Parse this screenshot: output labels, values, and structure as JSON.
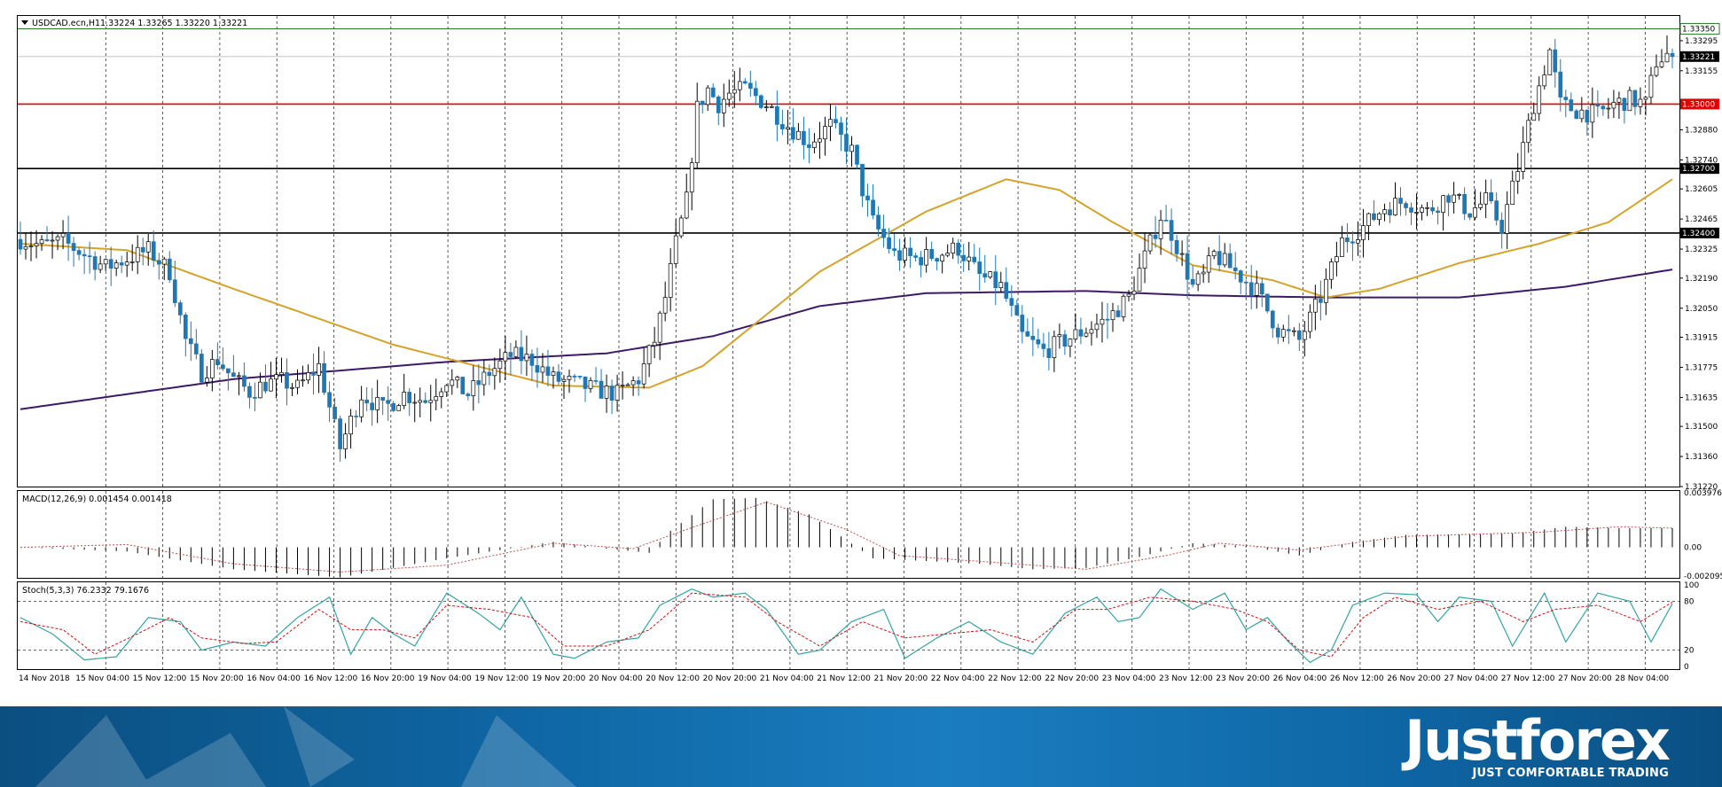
{
  "header": {
    "symbol_text": "USDCAD.ecn,H1",
    "ohlc_text": "1.33224 1.33265 1.33220 1.33221"
  },
  "macd_label": "MACD(12,26,9) 0.001454 0.001418",
  "stoch_label": "Stoch(5,3,3) 76.2332 79.1676",
  "colors": {
    "bull": "#ffffff",
    "bear": "#1f78b4",
    "ma_fast": "#d4a32c",
    "ma_slow": "#3d1a66",
    "resistance_red": "#e00000",
    "top_line_green": "#2a7a2a",
    "stoch_main": "#34a3a3",
    "stoch_signal": "#d01010",
    "macd_signal": "#c0504d"
  },
  "chart_data": [
    {
      "type": "candlestick",
      "title": "USDCAD.ecn,H1",
      "ylim": [
        1.3122,
        1.3341
      ],
      "y_ticks": [
        "1.33295",
        "1.33155",
        "1.32880",
        "1.32740",
        "1.32605",
        "1.32465",
        "1.32325",
        "1.32190",
        "1.32050",
        "1.31915",
        "1.31775",
        "1.31635",
        "1.31500",
        "1.31360",
        "1.31220"
      ],
      "x_ticks": [
        "14 Nov 2018",
        "15 Nov 04:00",
        "15 Nov 12:00",
        "15 Nov 20:00",
        "16 Nov 04:00",
        "16 Nov 12:00",
        "16 Nov 20:00",
        "19 Nov 04:00",
        "19 Nov 12:00",
        "19 Nov 20:00",
        "20 Nov 04:00",
        "20 Nov 12:00",
        "20 Nov 20:00",
        "21 Nov 04:00",
        "21 Nov 12:00",
        "21 Nov 20:00",
        "22 Nov 04:00",
        "22 Nov 12:00",
        "22 Nov 20:00",
        "23 Nov 04:00",
        "23 Nov 12:00",
        "23 Nov 20:00",
        "26 Nov 04:00",
        "26 Nov 12:00",
        "26 Nov 20:00",
        "27 Nov 04:00",
        "27 Nov 12:00",
        "27 Nov 20:00",
        "28 Nov 04:00"
      ],
      "horizontal_levels": [
        {
          "label": "1.33350",
          "value": 1.3335,
          "color": "green"
        },
        {
          "label": "1.33000",
          "value": 1.33,
          "color": "red"
        },
        {
          "label": "1.32700",
          "value": 1.327,
          "color": "black"
        },
        {
          "label": "1.32400",
          "value": 1.324,
          "color": "black"
        }
      ],
      "current_price_label": "1.33221",
      "current_price": 1.33221,
      "close_anchors": [
        [
          0,
          1.3237
        ],
        [
          4,
          1.3234
        ],
        [
          8,
          1.3236
        ],
        [
          12,
          1.323
        ],
        [
          16,
          1.3224
        ],
        [
          20,
          1.3228
        ],
        [
          24,
          1.3232
        ],
        [
          28,
          1.3222
        ],
        [
          31,
          1.319
        ],
        [
          34,
          1.3175
        ],
        [
          37,
          1.3181
        ],
        [
          40,
          1.3172
        ],
        [
          43,
          1.3166
        ],
        [
          46,
          1.317
        ],
        [
          49,
          1.3171
        ],
        [
          52,
          1.3168
        ],
        [
          56,
          1.3178
        ],
        [
          60,
          1.314
        ],
        [
          64,
          1.3165
        ],
        [
          68,
          1.3158
        ],
        [
          72,
          1.3165
        ],
        [
          76,
          1.3162
        ],
        [
          80,
          1.3172
        ],
        [
          84,
          1.3165
        ],
        [
          88,
          1.3175
        ],
        [
          92,
          1.3183
        ],
        [
          96,
          1.3181
        ],
        [
          100,
          1.3172
        ],
        [
          104,
          1.317
        ],
        [
          108,
          1.3167
        ],
        [
          112,
          1.3165
        ],
        [
          116,
          1.3172
        ],
        [
          119,
          1.319
        ],
        [
          121,
          1.321
        ],
        [
          123,
          1.3235
        ],
        [
          125,
          1.3255
        ],
        [
          127,
          1.3298
        ],
        [
          129,
          1.3307
        ],
        [
          131,
          1.33
        ],
        [
          133,
          1.3305
        ],
        [
          136,
          1.3307
        ],
        [
          140,
          1.33
        ],
        [
          144,
          1.329
        ],
        [
          148,
          1.3282
        ],
        [
          152,
          1.329
        ],
        [
          156,
          1.3278
        ],
        [
          158,
          1.326
        ],
        [
          160,
          1.3245
        ],
        [
          164,
          1.323
        ],
        [
          168,
          1.3228
        ],
        [
          172,
          1.323
        ],
        [
          176,
          1.3233
        ],
        [
          180,
          1.322
        ],
        [
          184,
          1.3215
        ],
        [
          188,
          1.3192
        ],
        [
          192,
          1.3185
        ],
        [
          196,
          1.319
        ],
        [
          200,
          1.3195
        ],
        [
          204,
          1.32
        ],
        [
          208,
          1.321
        ],
        [
          212,
          1.3235
        ],
        [
          214,
          1.3248
        ],
        [
          216,
          1.324
        ],
        [
          218,
          1.3228
        ],
        [
          220,
          1.3215
        ],
        [
          222,
          1.322
        ],
        [
          224,
          1.323
        ],
        [
          228,
          1.3222
        ],
        [
          232,
          1.3213
        ],
        [
          236,
          1.3195
        ],
        [
          240,
          1.319
        ],
        [
          244,
          1.321
        ],
        [
          248,
          1.3236
        ],
        [
          252,
          1.3243
        ],
        [
          256,
          1.3252
        ],
        [
          260,
          1.3255
        ],
        [
          264,
          1.325
        ],
        [
          268,
          1.3258
        ],
        [
          272,
          1.325
        ],
        [
          275,
          1.3255
        ],
        [
          278,
          1.3243
        ],
        [
          281,
          1.327
        ],
        [
          284,
          1.33
        ],
        [
          287,
          1.3325
        ],
        [
          289,
          1.33
        ],
        [
          292,
          1.3297
        ],
        [
          296,
          1.3295
        ],
        [
          299,
          1.33
        ],
        [
          302,
          1.3302
        ],
        [
          305,
          1.33
        ],
        [
          307,
          1.332
        ],
        [
          309,
          1.3323
        ],
        [
          310,
          1.33221
        ]
      ],
      "ma_fast_anchors": [
        [
          0,
          1.3235
        ],
        [
          20,
          1.3232
        ],
        [
          40,
          1.3214
        ],
        [
          70,
          1.3188
        ],
        [
          100,
          1.3169
        ],
        [
          118,
          1.3168
        ],
        [
          128,
          1.3178
        ],
        [
          140,
          1.3202
        ],
        [
          150,
          1.3222
        ],
        [
          170,
          1.325
        ],
        [
          185,
          1.3265
        ],
        [
          195,
          1.326
        ],
        [
          205,
          1.3245
        ],
        [
          220,
          1.3225
        ],
        [
          235,
          1.3218
        ],
        [
          245,
          1.321
        ],
        [
          255,
          1.3214
        ],
        [
          270,
          1.3226
        ],
        [
          285,
          1.3235
        ],
        [
          298,
          1.3245
        ],
        [
          310,
          1.3265
        ]
      ],
      "ma_slow_anchors": [
        [
          0,
          1.3158
        ],
        [
          40,
          1.3172
        ],
        [
          80,
          1.318
        ],
        [
          110,
          1.3184
        ],
        [
          130,
          1.3192
        ],
        [
          150,
          1.3206
        ],
        [
          170,
          1.3212
        ],
        [
          200,
          1.3213
        ],
        [
          220,
          1.3211
        ],
        [
          245,
          1.321
        ],
        [
          270,
          1.321
        ],
        [
          290,
          1.3215
        ],
        [
          310,
          1.3223
        ]
      ]
    },
    {
      "type": "bar",
      "title": "MACD(12,26,9)",
      "y_ticks": [
        "0.003976",
        "0.00",
        "-0.002095"
      ],
      "ylim": [
        -0.002095,
        0.003976
      ],
      "hist_anchors": [
        [
          0,
          0.0
        ],
        [
          20,
          -0.0003
        ],
        [
          40,
          -0.0016
        ],
        [
          60,
          -0.0022
        ],
        [
          80,
          -0.0008
        ],
        [
          100,
          0.0004
        ],
        [
          110,
          -0.0001
        ],
        [
          118,
          -0.0004
        ],
        [
          122,
          0.0012
        ],
        [
          130,
          0.0035
        ],
        [
          138,
          0.0036
        ],
        [
          148,
          0.0024
        ],
        [
          160,
          -0.0008
        ],
        [
          180,
          -0.0012
        ],
        [
          190,
          -0.0016
        ],
        [
          200,
          -0.0015
        ],
        [
          210,
          -0.0007
        ],
        [
          220,
          0.0003
        ],
        [
          230,
          0.0001
        ],
        [
          240,
          -0.0006
        ],
        [
          250,
          0.0004
        ],
        [
          260,
          0.0009
        ],
        [
          280,
          0.001
        ],
        [
          290,
          0.0015
        ],
        [
          300,
          0.0014
        ],
        [
          310,
          0.0014
        ]
      ],
      "signal_anchors": [
        [
          0,
          0.0
        ],
        [
          20,
          0.0002
        ],
        [
          40,
          -0.0012
        ],
        [
          60,
          -0.0018
        ],
        [
          80,
          -0.0013
        ],
        [
          100,
          0.0003
        ],
        [
          115,
          -0.0001
        ],
        [
          125,
          0.0013
        ],
        [
          140,
          0.0033
        ],
        [
          155,
          0.0013
        ],
        [
          165,
          -0.0006
        ],
        [
          190,
          -0.0013
        ],
        [
          200,
          -0.0016
        ],
        [
          215,
          -0.0006
        ],
        [
          225,
          0.0003
        ],
        [
          240,
          -0.0002
        ],
        [
          260,
          0.0008
        ],
        [
          285,
          0.0011
        ],
        [
          300,
          0.0015
        ],
        [
          310,
          0.0014
        ]
      ]
    },
    {
      "type": "line",
      "title": "Stoch(5,3,3)",
      "y_ticks": [
        "100",
        "80",
        "20",
        "0"
      ],
      "ylim": [
        0,
        100
      ],
      "main_anchors": [
        [
          0,
          60
        ],
        [
          6,
          40
        ],
        [
          12,
          8
        ],
        [
          18,
          12
        ],
        [
          24,
          60
        ],
        [
          30,
          55
        ],
        [
          34,
          20
        ],
        [
          40,
          30
        ],
        [
          46,
          25
        ],
        [
          52,
          60
        ],
        [
          58,
          85
        ],
        [
          62,
          15
        ],
        [
          66,
          60
        ],
        [
          70,
          40
        ],
        [
          74,
          25
        ],
        [
          80,
          90
        ],
        [
          86,
          65
        ],
        [
          90,
          45
        ],
        [
          94,
          85
        ],
        [
          100,
          15
        ],
        [
          104,
          10
        ],
        [
          110,
          30
        ],
        [
          116,
          35
        ],
        [
          120,
          75
        ],
        [
          126,
          95
        ],
        [
          130,
          85
        ],
        [
          136,
          90
        ],
        [
          140,
          70
        ],
        [
          146,
          15
        ],
        [
          150,
          20
        ],
        [
          156,
          55
        ],
        [
          162,
          70
        ],
        [
          166,
          10
        ],
        [
          172,
          35
        ],
        [
          178,
          55
        ],
        [
          184,
          30
        ],
        [
          190,
          15
        ],
        [
          196,
          65
        ],
        [
          202,
          85
        ],
        [
          206,
          55
        ],
        [
          210,
          60
        ],
        [
          214,
          95
        ],
        [
          220,
          70
        ],
        [
          226,
          90
        ],
        [
          230,
          45
        ],
        [
          234,
          60
        ],
        [
          238,
          30
        ],
        [
          242,
          5
        ],
        [
          246,
          20
        ],
        [
          250,
          75
        ],
        [
          256,
          90
        ],
        [
          262,
          88
        ],
        [
          266,
          55
        ],
        [
          270,
          85
        ],
        [
          276,
          80
        ],
        [
          280,
          25
        ],
        [
          286,
          90
        ],
        [
          290,
          30
        ],
        [
          296,
          90
        ],
        [
          302,
          80
        ],
        [
          306,
          30
        ],
        [
          310,
          77
        ]
      ],
      "signal_anchors": [
        [
          0,
          55
        ],
        [
          8,
          45
        ],
        [
          14,
          15
        ],
        [
          22,
          40
        ],
        [
          28,
          60
        ],
        [
          34,
          35
        ],
        [
          42,
          28
        ],
        [
          48,
          30
        ],
        [
          56,
          70
        ],
        [
          62,
          45
        ],
        [
          68,
          45
        ],
        [
          74,
          35
        ],
        [
          80,
          75
        ],
        [
          88,
          70
        ],
        [
          96,
          60
        ],
        [
          102,
          25
        ],
        [
          110,
          25
        ],
        [
          118,
          45
        ],
        [
          126,
          90
        ],
        [
          136,
          85
        ],
        [
          142,
          55
        ],
        [
          150,
          25
        ],
        [
          158,
          55
        ],
        [
          166,
          35
        ],
        [
          174,
          40
        ],
        [
          182,
          45
        ],
        [
          190,
          30
        ],
        [
          198,
          70
        ],
        [
          204,
          70
        ],
        [
          212,
          85
        ],
        [
          220,
          80
        ],
        [
          228,
          70
        ],
        [
          234,
          55
        ],
        [
          240,
          20
        ],
        [
          246,
          12
        ],
        [
          252,
          60
        ],
        [
          258,
          85
        ],
        [
          266,
          70
        ],
        [
          274,
          80
        ],
        [
          282,
          55
        ],
        [
          288,
          70
        ],
        [
          296,
          75
        ],
        [
          304,
          55
        ],
        [
          310,
          79
        ]
      ]
    }
  ],
  "footer": {
    "brand_name": "Justforex",
    "brand_tagline": "JUST COMFORTABLE TRADING"
  }
}
